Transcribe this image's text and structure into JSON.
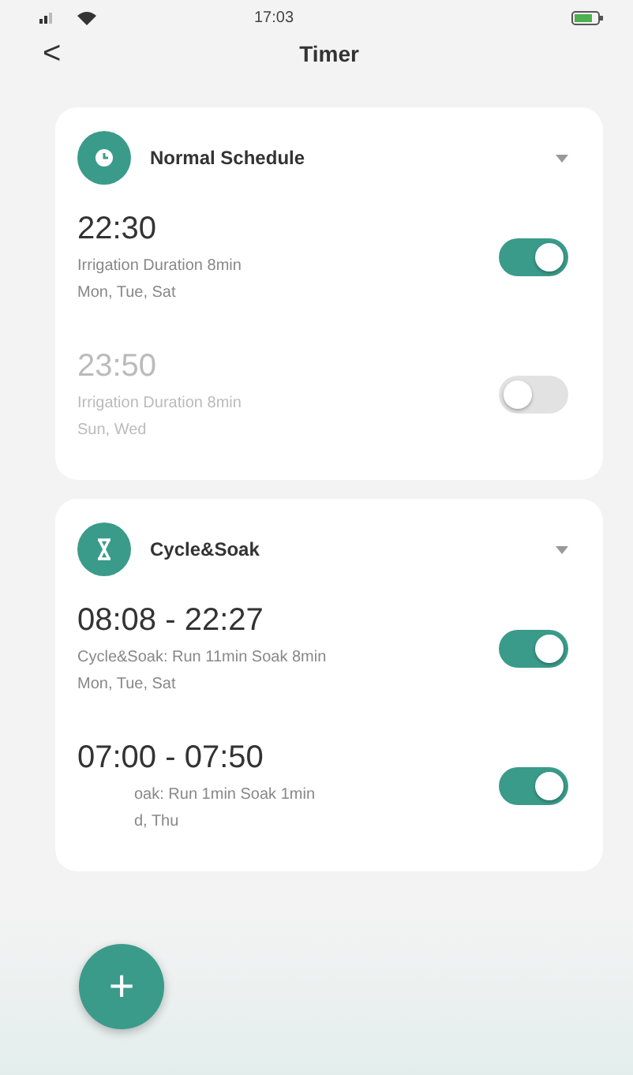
{
  "status_bar": {
    "time": "17:03"
  },
  "header": {
    "back": "<",
    "title": "Timer"
  },
  "groups": [
    {
      "kind": "schedule",
      "title": "Normal Schedule",
      "expanded": true,
      "items": [
        {
          "time": "22:30",
          "detail": "Irrigation Duration 8min",
          "days": "Mon, Tue, Sat",
          "on": true
        },
        {
          "time": "23:50",
          "detail": "Irrigation Duration 8min",
          "days": "Sun, Wed",
          "on": false
        }
      ]
    },
    {
      "kind": "cycle",
      "title": "Cycle&Soak",
      "expanded": true,
      "items": [
        {
          "time": "08:08 - 22:27",
          "detail": "Cycle&Soak: Run 11min Soak 8min",
          "days": "Mon, Tue, Sat",
          "on": true
        },
        {
          "time": "07:00 - 07:50",
          "detail": "oak: Run 1min Soak 1min",
          "days": "d, Thu",
          "on": true
        }
      ]
    }
  ],
  "add_button": {
    "label": "+"
  }
}
